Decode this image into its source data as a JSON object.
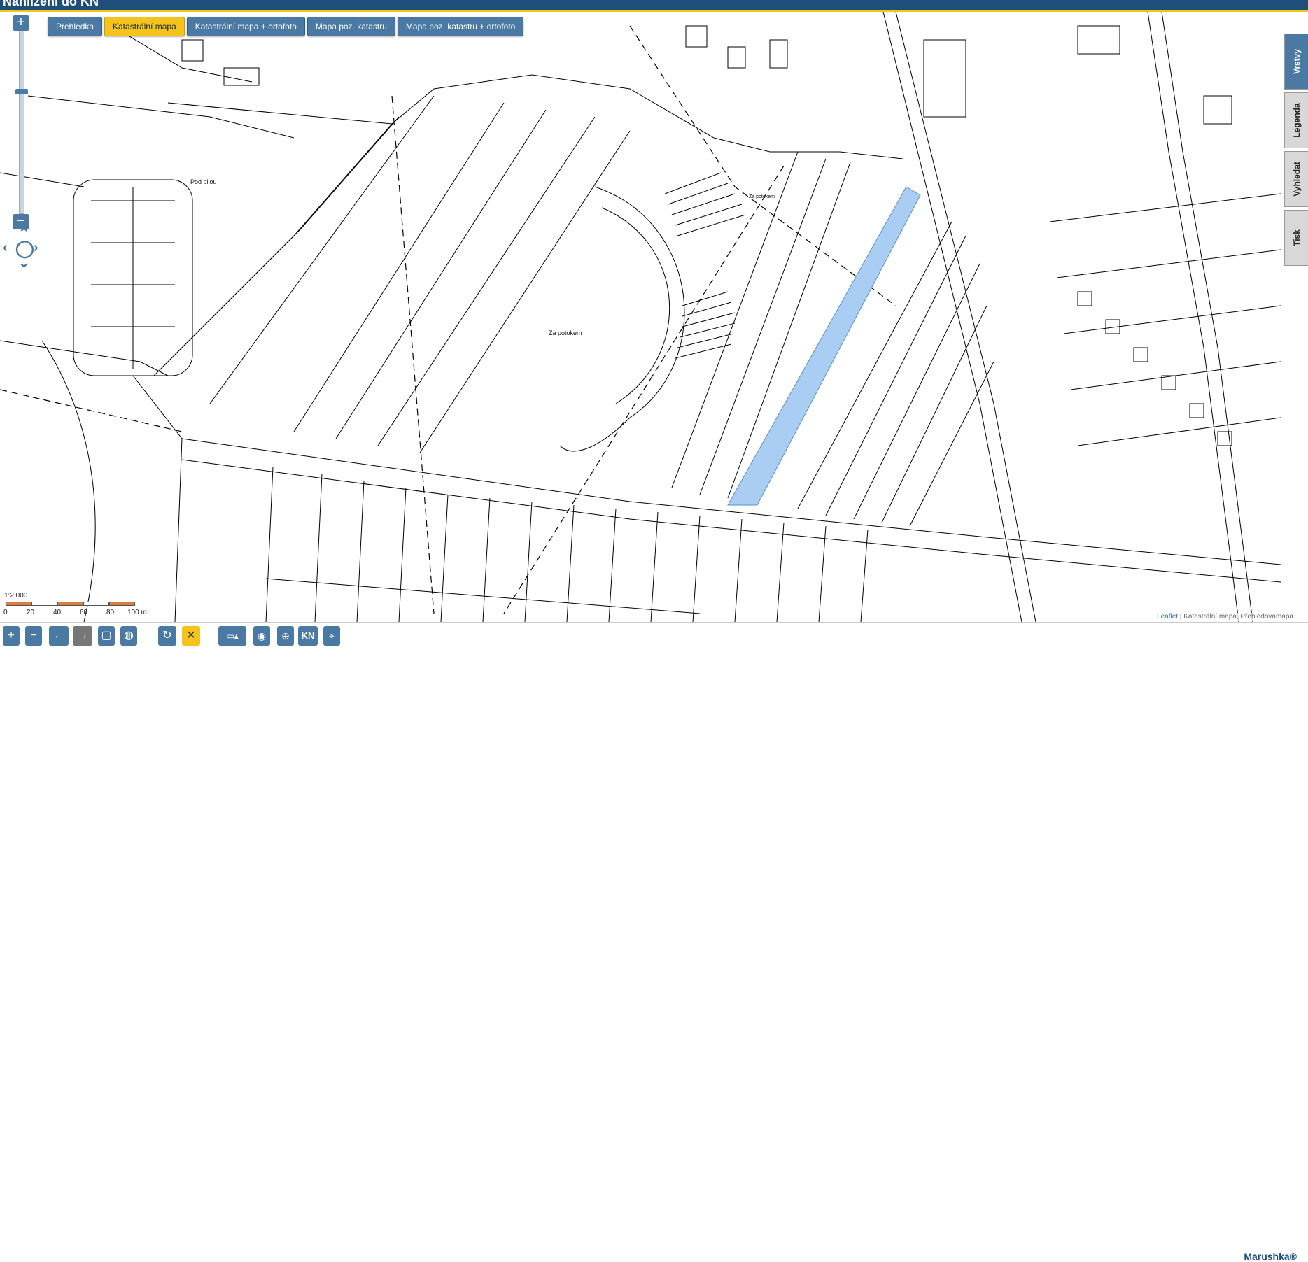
{
  "header": {
    "title": "Nahlížení do KN"
  },
  "tabs": [
    {
      "label": "Přehledka",
      "active": false
    },
    {
      "label": "Katastrální mapa",
      "active": true
    },
    {
      "label": "Katastrální mapa + ortofoto",
      "active": false
    },
    {
      "label": "Mapa poz. katastru",
      "active": false
    },
    {
      "label": "Mapa poz. katastru + ortofoto",
      "active": false
    }
  ],
  "zoom": {
    "in": "+",
    "out": "−"
  },
  "sidebar": {
    "items": [
      "Vrstvy",
      "Legenda",
      "Vyhledat",
      "Tisk"
    ]
  },
  "map": {
    "labels": {
      "pod_pilou": "Pod pilou",
      "za_potokem_1": "Za potokem",
      "za_potokem_2": "Za potokem"
    },
    "highlight_color": "#a9cdf3"
  },
  "scale": {
    "ratio": "1:2 000",
    "ticks": [
      "0",
      "20",
      "40",
      "60",
      "80",
      "100 m"
    ]
  },
  "attribution": {
    "leaflet": "Leaflet",
    "text": " | Katastrální mapa, Přehledovámapa"
  },
  "brand": "Marushka®",
  "toolbar": {
    "kn": "KN"
  }
}
